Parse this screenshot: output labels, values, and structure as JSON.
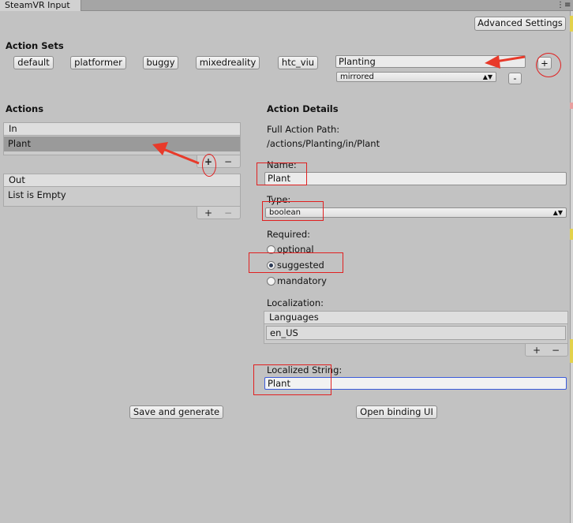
{
  "window": {
    "tab_title": "SteamVR Input",
    "menu_glyph": "⋮≡"
  },
  "toolbar": {
    "advanced_settings_label": "Advanced Settings"
  },
  "action_sets": {
    "heading": "Action Sets",
    "items": [
      "default",
      "platformer",
      "buggy",
      "mixedreality",
      "htc_viu"
    ],
    "name_value": "Planting",
    "usage_value": "mirrored",
    "add_label": "+",
    "remove_label": "-"
  },
  "actions": {
    "heading": "Actions",
    "in": {
      "header": "In",
      "items": [
        "Plant"
      ],
      "add_label": "+",
      "remove_label": "−"
    },
    "out": {
      "header": "Out",
      "empty_text": "List is Empty",
      "add_label": "+",
      "remove_label": "−"
    }
  },
  "details": {
    "heading": "Action Details",
    "full_path_label": "Full Action Path:",
    "full_path_value": "/actions/Planting/in/Plant",
    "name_label": "Name:",
    "name_value": "Plant",
    "type_label": "Type:",
    "type_value": "boolean",
    "required_label": "Required:",
    "required_options": [
      "optional",
      "suggested",
      "mandatory"
    ],
    "required_selected": "suggested",
    "localization_label": "Localization:",
    "languages_header": "Languages",
    "languages": [
      "en_US"
    ],
    "lang_add_label": "+",
    "lang_remove_label": "−",
    "localized_string_label": "Localized String:",
    "localized_string_value": "Plant"
  },
  "footer": {
    "save_label": "Save and generate",
    "open_binding_label": "Open binding UI"
  },
  "colors": {
    "annotation": "#e02020",
    "panel_bg": "#c2c2c2",
    "selection": "#9a9a9a",
    "focus_border": "#3b5bdb"
  }
}
